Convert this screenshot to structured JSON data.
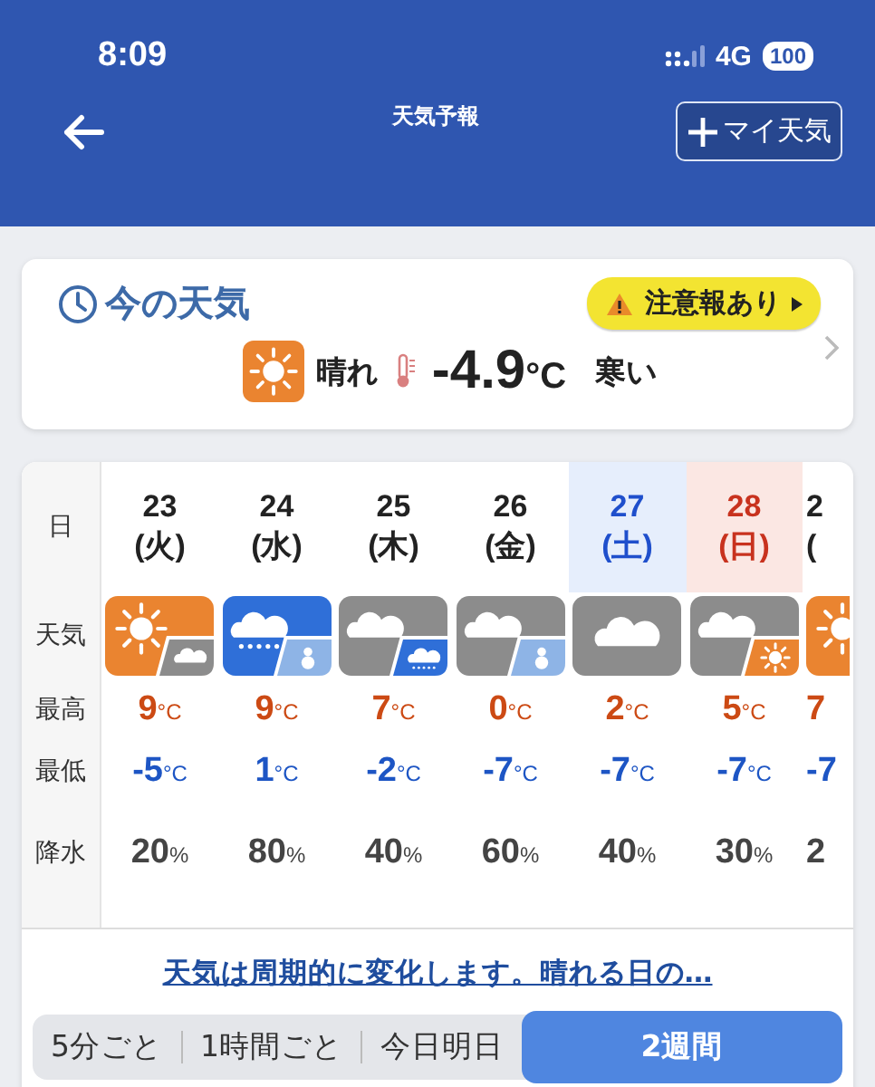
{
  "status_bar": {
    "time": "8:09",
    "network": "4G",
    "battery": "100"
  },
  "header": {
    "title": "天気予報",
    "add_button": "マイ天気"
  },
  "current": {
    "title": "今の天気",
    "alert": "注意報あり",
    "icon": {
      "kind": "sun"
    },
    "condition": "晴れ",
    "temp": "-4.9",
    "unit": "°C",
    "feel": "寒い"
  },
  "forecast": {
    "labels": [
      "日",
      "天気",
      "最高",
      "最低",
      "降水"
    ],
    "days": [
      {
        "day": "23",
        "weekday": "(火)",
        "kind": "weekday",
        "icon": [
          {
            "kind": "sun"
          },
          {
            "kind": "cloud"
          }
        ],
        "high": {
          "value": "9",
          "unit": "°C"
        },
        "low": {
          "value": "-5",
          "unit": "°C"
        },
        "precip": {
          "value": "20",
          "unit": "%"
        }
      },
      {
        "day": "24",
        "weekday": "(水)",
        "kind": "weekday",
        "icon": [
          {
            "kind": "rain"
          },
          {
            "kind": "snow"
          }
        ],
        "high": {
          "value": "9",
          "unit": "°C"
        },
        "low": {
          "value": "1",
          "unit": "°C"
        },
        "precip": {
          "value": "80",
          "unit": "%"
        }
      },
      {
        "day": "25",
        "weekday": "(木)",
        "kind": "weekday",
        "icon": [
          {
            "kind": "cloud"
          },
          {
            "kind": "rain"
          }
        ],
        "high": {
          "value": "7",
          "unit": "°C"
        },
        "low": {
          "value": "-2",
          "unit": "°C"
        },
        "precip": {
          "value": "40",
          "unit": "%"
        }
      },
      {
        "day": "26",
        "weekday": "(金)",
        "kind": "weekday",
        "icon": [
          {
            "kind": "cloud"
          },
          {
            "kind": "snow"
          }
        ],
        "high": {
          "value": "0",
          "unit": "°C"
        },
        "low": {
          "value": "-7",
          "unit": "°C"
        },
        "precip": {
          "value": "60",
          "unit": "%"
        }
      },
      {
        "day": "27",
        "weekday": "(土)",
        "kind": "saturday",
        "icon": [
          {
            "kind": "cloud"
          }
        ],
        "high": {
          "value": "2",
          "unit": "°C"
        },
        "low": {
          "value": "-7",
          "unit": "°C"
        },
        "precip": {
          "value": "40",
          "unit": "%"
        }
      },
      {
        "day": "28",
        "weekday": "(日)",
        "kind": "sunday",
        "icon": [
          {
            "kind": "cloud"
          },
          {
            "kind": "sun"
          }
        ],
        "high": {
          "value": "5",
          "unit": "°C"
        },
        "low": {
          "value": "-7",
          "unit": "°C"
        },
        "precip": {
          "value": "30",
          "unit": "%"
        }
      },
      {
        "day": "2",
        "weekday": "(",
        "kind": "weekday",
        "partial": true,
        "icon": [
          {
            "kind": "sun"
          }
        ],
        "high": {
          "value": "7"
        },
        "low": {
          "value": "-7"
        },
        "precip": {
          "value": "2"
        }
      }
    ]
  },
  "link": "天気は周期的に変化します。晴れる日の…",
  "segments": [
    {
      "label": "5分ごと",
      "selected": false
    },
    {
      "label": "1時間ごと",
      "selected": false
    },
    {
      "label": "今日明日",
      "selected": false
    },
    {
      "label": "2週間",
      "selected": true
    }
  ]
}
